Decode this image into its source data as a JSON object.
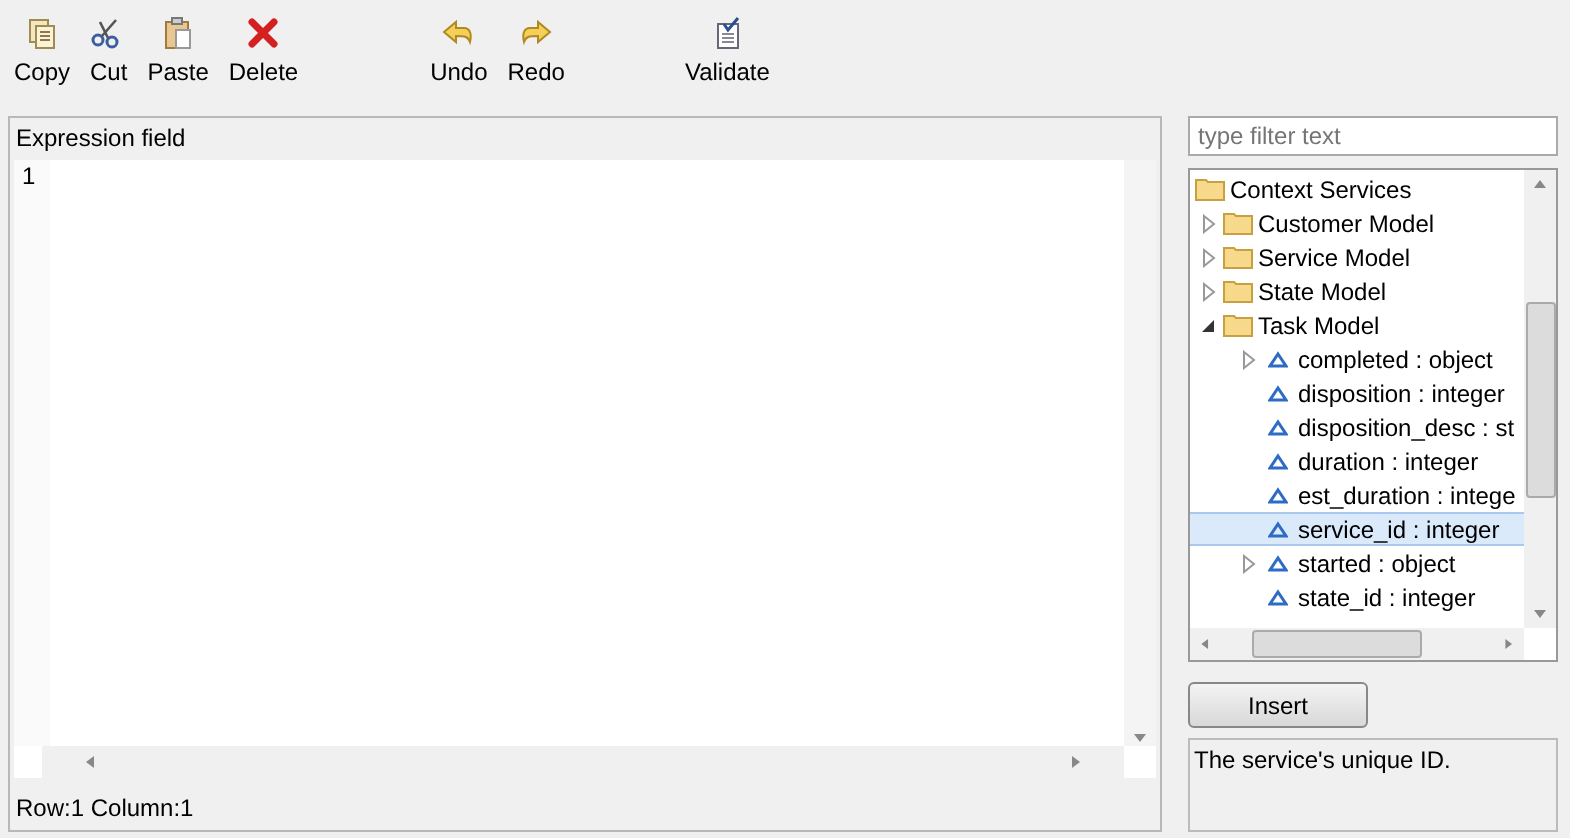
{
  "toolbar": [
    {
      "label": "Copy",
      "kind": "copy"
    },
    {
      "label": "Cut",
      "kind": "cut"
    },
    {
      "label": "Paste",
      "kind": "paste"
    },
    {
      "label": "Delete",
      "kind": "delete"
    },
    {
      "label": "Undo",
      "kind": "undo"
    },
    {
      "label": "Redo",
      "kind": "redo"
    },
    {
      "label": "Validate",
      "kind": "validate"
    }
  ],
  "expression": {
    "title": "Expression field",
    "line_numbers": [
      "1"
    ],
    "status": "Row:1 Column:1"
  },
  "filter": {
    "placeholder": "type filter text"
  },
  "tree": [
    {
      "label": "Context Services",
      "kind": "folder",
      "selected": false,
      "children": [
        {
          "label": "Customer Model",
          "kind": "folder",
          "expanded": false,
          "selected": false
        },
        {
          "label": "Service Model",
          "kind": "folder",
          "expanded": false,
          "selected": false
        },
        {
          "label": "State Model",
          "kind": "folder",
          "expanded": false,
          "selected": false
        },
        {
          "label": "Task Model",
          "kind": "folder",
          "expanded": true,
          "selected": false,
          "children": [
            {
              "label": "completed : object",
              "kind": "field",
              "expanded": false,
              "selected": false
            },
            {
              "label": "disposition : integer",
              "kind": "field",
              "selected": false
            },
            {
              "label": "disposition_desc : st",
              "kind": "field",
              "selected": false
            },
            {
              "label": "duration : integer",
              "kind": "field",
              "selected": false
            },
            {
              "label": "est_duration : intege",
              "kind": "field",
              "selected": false
            },
            {
              "label": "service_id : integer",
              "kind": "field",
              "selected": true
            },
            {
              "label": "started : object",
              "kind": "field",
              "expanded": false,
              "selected": false
            },
            {
              "label": "state_id : integer",
              "kind": "field",
              "selected": false
            }
          ]
        }
      ]
    }
  ],
  "insert_button": "Insert",
  "description": "The service's unique ID."
}
